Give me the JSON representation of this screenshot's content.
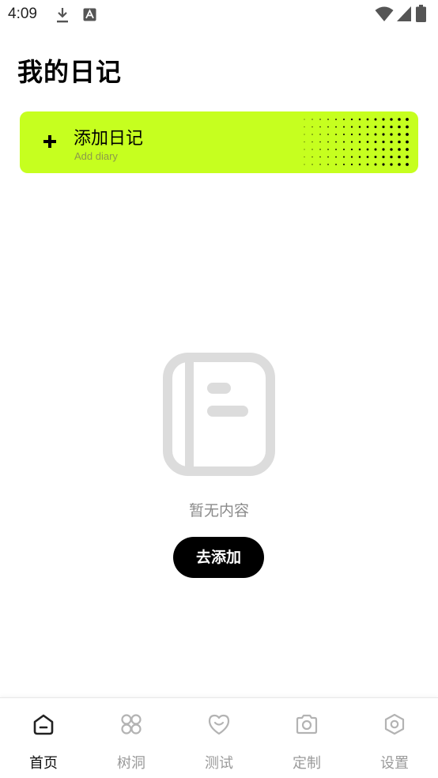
{
  "status_bar": {
    "time": "4:09",
    "icons": [
      "download-icon",
      "text-a-icon",
      "wifi-icon",
      "signal-icon",
      "battery-icon"
    ]
  },
  "page": {
    "title": "我的日记"
  },
  "add_card": {
    "title": "添加日记",
    "subtitle": "Add diary",
    "accent_color": "#c6ff1f"
  },
  "empty_state": {
    "icon": "notebook-icon",
    "message": "暂无内容",
    "button_label": "去添加"
  },
  "bottom_nav": {
    "items": [
      {
        "label": "首页",
        "icon": "home-icon",
        "active": true
      },
      {
        "label": "树洞",
        "icon": "clover-icon",
        "active": false
      },
      {
        "label": "测试",
        "icon": "heart-smile-icon",
        "active": false
      },
      {
        "label": "定制",
        "icon": "camera-icon",
        "active": false
      },
      {
        "label": "设置",
        "icon": "settings-hexagon-icon",
        "active": false
      }
    ]
  }
}
